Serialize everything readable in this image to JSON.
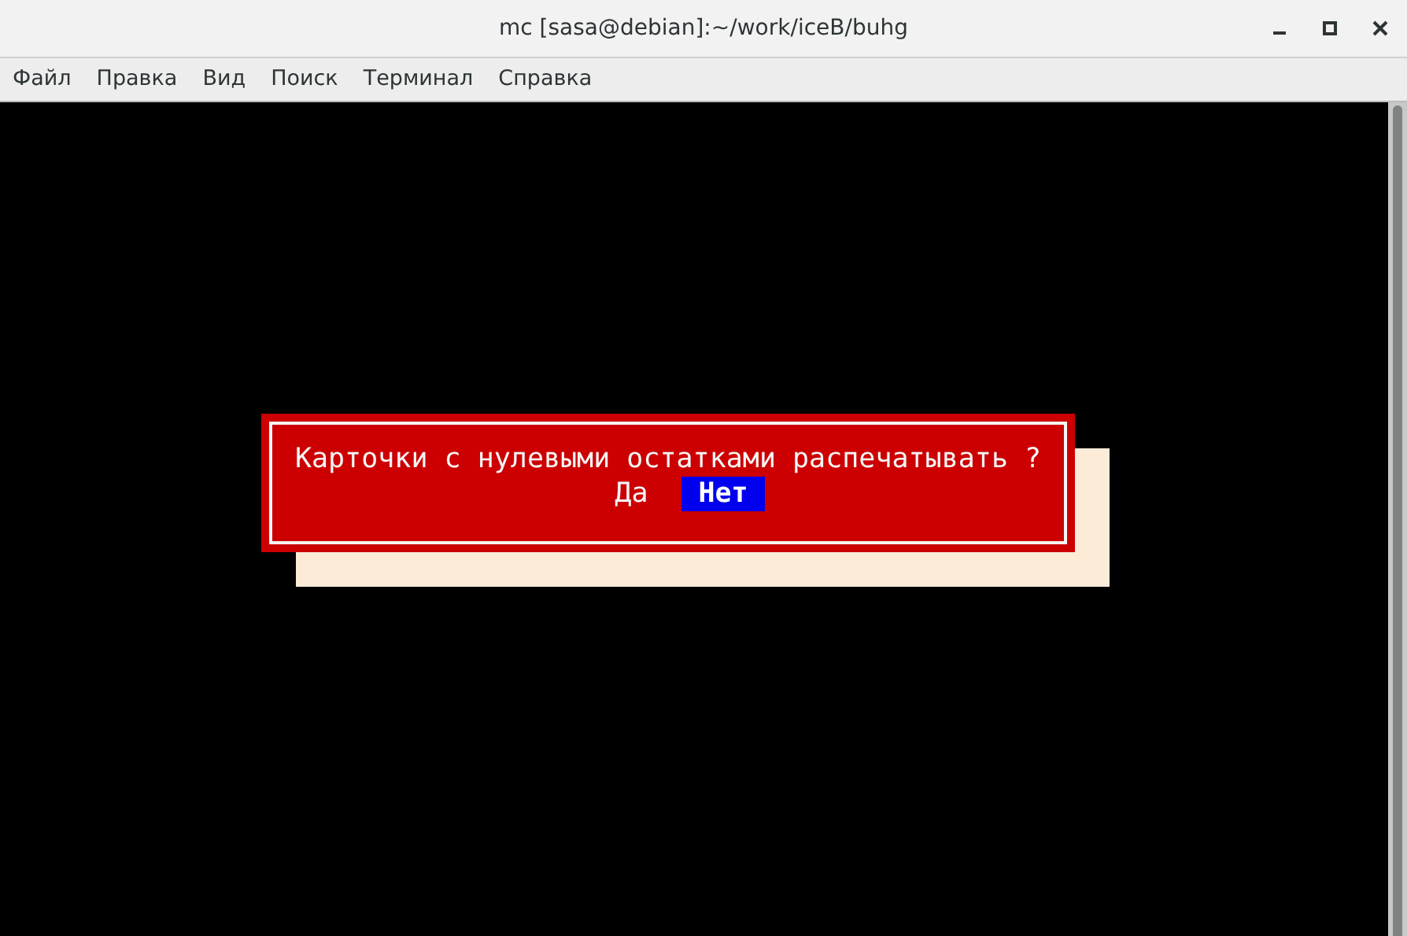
{
  "window": {
    "title": "mc [sasa@debian]:~/work/iceB/buhg"
  },
  "menu": [
    "Файл",
    "Правка",
    "Вид",
    "Поиск",
    "Терминал",
    "Справка"
  ],
  "dialog": {
    "message": "Карточки с нулевыми остатками распечатывать ?",
    "buttons": [
      {
        "label": "Да",
        "selected": false
      },
      {
        "label": "Нет",
        "selected": true
      }
    ]
  }
}
